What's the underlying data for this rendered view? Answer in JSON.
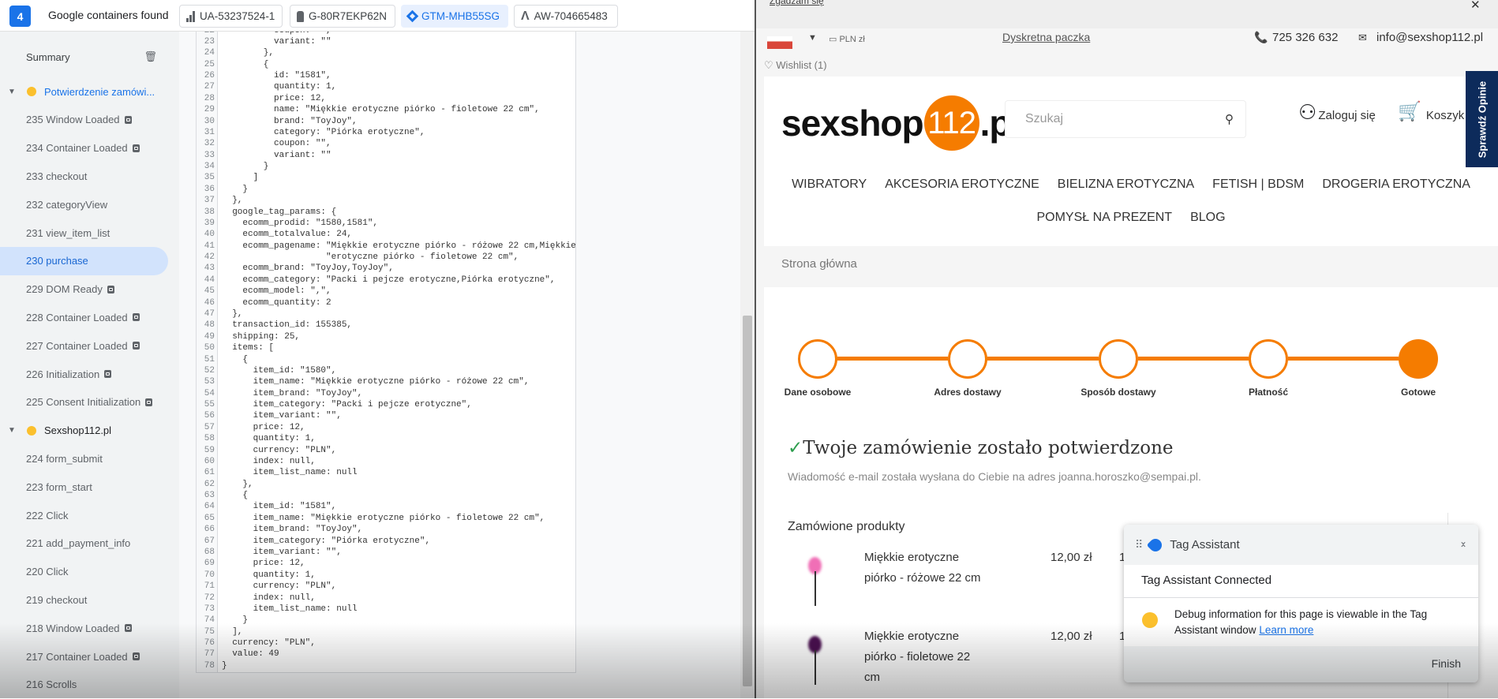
{
  "topbar": {
    "count": "4",
    "title": "Google containers found",
    "containers": [
      {
        "id": "UA-53237524-1",
        "icon": "analytics-icon",
        "active": false
      },
      {
        "id": "G-80R7EKP62N",
        "icon": "tag-icon",
        "active": false
      },
      {
        "id": "GTM-MHB55SG",
        "icon": "gtm-diamond-icon",
        "active": true
      },
      {
        "id": "AW-704665483",
        "icon": "google-ads-icon",
        "active": false
      }
    ]
  },
  "sidebar": {
    "summary": "Summary",
    "items": [
      {
        "label": "Potwierdzenie zamówi...",
        "group": true,
        "highlight": true
      },
      {
        "label": "235 Window Loaded",
        "icon": true
      },
      {
        "label": "234 Container Loaded",
        "icon": true
      },
      {
        "label": "233 checkout"
      },
      {
        "label": "232 categoryView"
      },
      {
        "label": "231 view_item_list"
      },
      {
        "label": "230 purchase",
        "selected": true
      },
      {
        "label": "229 DOM Ready",
        "icon": true
      },
      {
        "label": "228 Container Loaded",
        "icon": true
      },
      {
        "label": "227 Container Loaded",
        "icon": true
      },
      {
        "label": "226 Initialization",
        "icon": true
      },
      {
        "label": "225 Consent Initialization",
        "icon": true
      },
      {
        "label": "Sexshop112.pl",
        "group": true
      },
      {
        "label": "224 form_submit"
      },
      {
        "label": "223 form_start"
      },
      {
        "label": "222 Click"
      },
      {
        "label": "221 add_payment_info"
      },
      {
        "label": "220 Click"
      },
      {
        "label": "219 checkout"
      },
      {
        "label": "218 Window Loaded",
        "icon": true
      },
      {
        "label": "217 Container Loaded",
        "icon": true
      },
      {
        "label": "216 Scrolls"
      }
    ]
  },
  "code": {
    "first_line": 22,
    "lines": [
      "          coupon: \"\",",
      "          variant: \"\"",
      "        },",
      "        {",
      "          id: \"1581\",",
      "          quantity: 1,",
      "          price: 12,",
      "          name: \"Miękkie erotyczne piórko - fioletowe 22 cm\",",
      "          brand: \"ToyJoy\",",
      "          category: \"Piórka erotyczne\",",
      "          coupon: \"\",",
      "          variant: \"\"",
      "        }",
      "      ]",
      "    }",
      "  },",
      "  google_tag_params: {",
      "    ecomm_prodid: \"1580,1581\",",
      "    ecomm_totalvalue: 24,",
      "    ecomm_pagename: \"Miękkie erotyczne piórko - różowe 22 cm,Miękkie \" +",
      "                    \"erotyczne piórko - fioletowe 22 cm\",",
      "    ecomm_brand: \"ToyJoy,ToyJoy\",",
      "    ecomm_category: \"Packi i pejcze erotyczne,Piórka erotyczne\",",
      "    ecomm_model: \",\",",
      "    ecomm_quantity: 2",
      "  },",
      "  transaction_id: 155385,",
      "  shipping: 25,",
      "  items: [",
      "    {",
      "      item_id: \"1580\",",
      "      item_name: \"Miękkie erotyczne piórko - różowe 22 cm\",",
      "      item_brand: \"ToyJoy\",",
      "      item_category: \"Packi i pejcze erotyczne\",",
      "      item_variant: \"\",",
      "      price: 12,",
      "      quantity: 1,",
      "      currency: \"PLN\",",
      "      index: null,",
      "      item_list_name: null",
      "    },",
      "    {",
      "      item_id: \"1581\",",
      "      item_name: \"Miękkie erotyczne piórko - fioletowe 22 cm\",",
      "      item_brand: \"ToyJoy\",",
      "      item_category: \"Piórka erotyczne\",",
      "      item_variant: \"\",",
      "      price: 12,",
      "      quantity: 1,",
      "      currency: \"PLN\",",
      "      index: null,",
      "      item_list_name: null",
      "    }",
      "  ],",
      "  currency: \"PLN\",",
      "  value: 49",
      "}"
    ]
  },
  "shop": {
    "cookie_accept": "Zgadzam się",
    "close": "✕",
    "currency": "PLN zł",
    "discreet": "Dyskretna paczka",
    "phone": "725 326 632",
    "email": "info@sexshop112.pl",
    "wishlist": "Wishlist (1)",
    "logo": {
      "pre": "sexshop",
      "num": "112",
      "post": ".pl"
    },
    "search_placeholder": "Szukaj",
    "login": "Zaloguj się",
    "cart": "Koszyk",
    "reviews_tab": "Sprawdź Opinie",
    "nav_row1": [
      "WIBRATORY",
      "AKCESORIA EROTYCZNE",
      "BIELIZNA EROTYCZNA",
      "FETISH | BDSM",
      "DROGERIA EROTYCZNA"
    ],
    "nav_row2": [
      "POMYSŁ NA PREZENT",
      "BLOG"
    ],
    "breadcrumb": "Strona główna",
    "steps": [
      {
        "label": "Dane osobowe",
        "done": false
      },
      {
        "label": "Adres dostawy",
        "done": false
      },
      {
        "label": "Sposób dostawy",
        "done": false
      },
      {
        "label": "Płatność",
        "done": false
      },
      {
        "label": "Gotowe",
        "done": true
      }
    ],
    "confirm_title": "Twoje zamówienie zostało potwierdzone",
    "confirm_text": "Wiadomość e-mail została wysłana do Ciebie na adres joanna.horoszko@sempai.pl.",
    "ordered_title": "Zamówione produkty",
    "products": [
      {
        "name": "Miękkie erotyczne piórko - różowe 22 cm",
        "price": "12,00 zł",
        "qty": "1",
        "color": "#f06fb6"
      },
      {
        "name": "Miękkie erotyczne piórko - fioletowe 22 cm",
        "price": "12,00 zł",
        "qty": "1",
        "color": "#4a1050"
      }
    ],
    "accent": "#f57c00"
  },
  "tag_assistant": {
    "title": "Tag Assistant",
    "status": "Tag Assistant Connected",
    "message": "Debug information for this page is viewable in the Tag Assistant window",
    "learn_more": "Learn more",
    "finish": "Finish"
  }
}
